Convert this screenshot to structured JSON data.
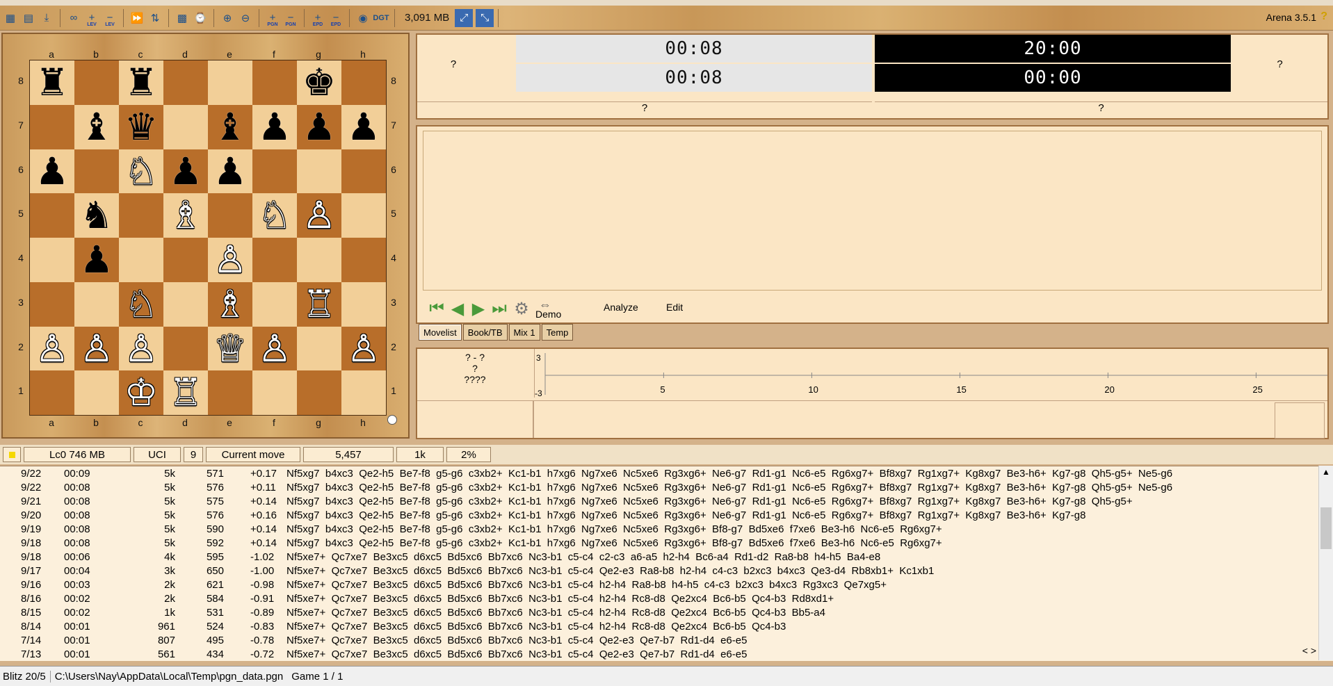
{
  "toolbar": {
    "icons": [
      {
        "name": "board-icon",
        "glyph": "▦",
        "sub": ""
      },
      {
        "name": "open-icon",
        "glyph": "▤",
        "sub": ""
      },
      {
        "name": "save-icon",
        "glyph": "⤓",
        "sub": ""
      },
      {
        "name": "infinite-icon",
        "glyph": "∞",
        "sub": ""
      },
      {
        "name": "level-plus-icon",
        "glyph": "+",
        "sub": "LEV"
      },
      {
        "name": "level-minus-icon",
        "glyph": "−",
        "sub": "LEV"
      },
      {
        "name": "fast-forward-icon",
        "glyph": "⏩",
        "sub": ""
      },
      {
        "name": "flip-icon",
        "glyph": "⇅",
        "sub": ""
      },
      {
        "name": "board-setup-icon",
        "glyph": "▩",
        "sub": ""
      },
      {
        "name": "chess-clock-icon",
        "glyph": "⌚",
        "sub": ""
      },
      {
        "name": "zoom-in-icon",
        "glyph": "⊕",
        "sub": ""
      },
      {
        "name": "zoom-out-icon",
        "glyph": "⊖",
        "sub": ""
      },
      {
        "name": "pgn-plus-icon",
        "glyph": "+",
        "sub": "PGN"
      },
      {
        "name": "pgn-minus-icon",
        "glyph": "−",
        "sub": "PGN"
      },
      {
        "name": "epd-plus-icon",
        "glyph": "+",
        "sub": "EPD"
      },
      {
        "name": "epd-minus-icon",
        "glyph": "−",
        "sub": "EPD"
      },
      {
        "name": "globe-icon",
        "glyph": "◉",
        "sub": ""
      },
      {
        "name": "dgt-icon",
        "glyph": "DGT",
        "sub": ""
      }
    ],
    "memory": "3,091 MB",
    "version": "Arena 3.5.1",
    "version_icon": "?"
  },
  "board": {
    "files": [
      "a",
      "b",
      "c",
      "d",
      "e",
      "f",
      "g",
      "h"
    ],
    "ranks": [
      "8",
      "7",
      "6",
      "5",
      "4",
      "3",
      "2",
      "1"
    ],
    "position": [
      [
        "br",
        "",
        "br",
        "",
        "",
        "",
        "bk",
        ""
      ],
      [
        "",
        "bb",
        "bq",
        "",
        "bb",
        "bp",
        "bp",
        "bp"
      ],
      [
        "bp",
        "",
        "wn",
        "bp",
        "bp",
        "",
        "",
        ""
      ],
      [
        "",
        "bn",
        "",
        "wb",
        "",
        "wn",
        "wp",
        ""
      ],
      [
        "",
        "bp",
        "",
        "",
        "wp",
        "",
        "",
        ""
      ],
      [
        "",
        "",
        "wn",
        "",
        "wb",
        "",
        "wr",
        ""
      ],
      [
        "wp",
        "wp",
        "wp",
        "",
        "wq",
        "wp",
        "",
        "wp"
      ],
      [
        "",
        "",
        "wk",
        "wr",
        "",
        "",
        "",
        ""
      ]
    ]
  },
  "clock": {
    "white_top": "00:08",
    "white_bottom": "00:08",
    "black_top": "20:00",
    "black_bottom": "00:00",
    "left_q": "?",
    "right_q": "?",
    "bottom_left_q": "?",
    "bottom_right_q": "?"
  },
  "nav": {
    "demo": "Demo",
    "analyze": "Analyze",
    "edit": "Edit"
  },
  "tabs": [
    "Movelist",
    "Book/TB",
    "Mix 1",
    "Temp"
  ],
  "graph": {
    "line1": "? - ?",
    "line2": "?",
    "line3": "????",
    "y_top": "3",
    "y_bottom": "-3",
    "x_ticks": [
      "5",
      "10",
      "15",
      "20",
      "25"
    ]
  },
  "engine_status": {
    "engine": "Lc0  746 MB",
    "protocol": "UCI",
    "depth": "9",
    "mode": "Current move",
    "nodes": "5,457",
    "nps": "1k",
    "percent": "2%"
  },
  "analysis": [
    {
      "depth": "9/22",
      "time": "00:09",
      "nodes": "5k",
      "nps": "571",
      "eval": "+0.17",
      "pv": "Nf5xg7  b4xc3  Qe2-h5  Be7-f8  g5-g6  c3xb2+  Kc1-b1  h7xg6  Ng7xe6  Nc5xe6  Rg3xg6+  Ne6-g7  Rd1-g1  Nc6-e5  Rg6xg7+  Bf8xg7  Rg1xg7+  Kg8xg7  Be3-h6+  Kg7-g8  Qh5-g5+  Ne5-g6"
    },
    {
      "depth": "9/22",
      "time": "00:08",
      "nodes": "5k",
      "nps": "576",
      "eval": "+0.11",
      "pv": "Nf5xg7  b4xc3  Qe2-h5  Be7-f8  g5-g6  c3xb2+  Kc1-b1  h7xg6  Ng7xe6  Nc5xe6  Rg3xg6+  Ne6-g7  Rd1-g1  Nc6-e5  Rg6xg7+  Bf8xg7  Rg1xg7+  Kg8xg7  Be3-h6+  Kg7-g8  Qh5-g5+  Ne5-g6"
    },
    {
      "depth": "9/21",
      "time": "00:08",
      "nodes": "5k",
      "nps": "575",
      "eval": "+0.14",
      "pv": "Nf5xg7  b4xc3  Qe2-h5  Be7-f8  g5-g6  c3xb2+  Kc1-b1  h7xg6  Ng7xe6  Nc5xe6  Rg3xg6+  Ne6-g7  Rd1-g1  Nc6-e5  Rg6xg7+  Bf8xg7  Rg1xg7+  Kg8xg7  Be3-h6+  Kg7-g8  Qh5-g5+"
    },
    {
      "depth": "9/20",
      "time": "00:08",
      "nodes": "5k",
      "nps": "576",
      "eval": "+0.16",
      "pv": "Nf5xg7  b4xc3  Qe2-h5  Be7-f8  g5-g6  c3xb2+  Kc1-b1  h7xg6  Ng7xe6  Nc5xe6  Rg3xg6+  Ne6-g7  Rd1-g1  Nc6-e5  Rg6xg7+  Bf8xg7  Rg1xg7+  Kg8xg7  Be3-h6+  Kg7-g8"
    },
    {
      "depth": "9/19",
      "time": "00:08",
      "nodes": "5k",
      "nps": "590",
      "eval": "+0.14",
      "pv": "Nf5xg7  b4xc3  Qe2-h5  Be7-f8  g5-g6  c3xb2+  Kc1-b1  h7xg6  Ng7xe6  Nc5xe6  Rg3xg6+  Bf8-g7  Bd5xe6  f7xe6  Be3-h6  Nc6-e5  Rg6xg7+"
    },
    {
      "depth": "9/18",
      "time": "00:08",
      "nodes": "5k",
      "nps": "592",
      "eval": "+0.14",
      "pv": "Nf5xg7  b4xc3  Qe2-h5  Be7-f8  g5-g6  c3xb2+  Kc1-b1  h7xg6  Ng7xe6  Nc5xe6  Rg3xg6+  Bf8-g7  Bd5xe6  f7xe6  Be3-h6  Nc6-e5  Rg6xg7+"
    },
    {
      "depth": "9/18",
      "time": "00:06",
      "nodes": "4k",
      "nps": "595",
      "eval": "-1.02",
      "pv": "Nf5xe7+  Qc7xe7  Be3xc5  d6xc5  Bd5xc6  Bb7xc6  Nc3-b1  c5-c4  c2-c3  a6-a5  h2-h4  Bc6-a4  Rd1-d2  Ra8-b8  h4-h5  Ba4-e8"
    },
    {
      "depth": "9/17",
      "time": "00:04",
      "nodes": "3k",
      "nps": "650",
      "eval": "-1.00",
      "pv": "Nf5xe7+  Qc7xe7  Be3xc5  d6xc5  Bd5xc6  Bb7xc6  Nc3-b1  c5-c4  Qe2-e3  Ra8-b8  h2-h4  c4-c3  b2xc3  b4xc3  Qe3-d4  Rb8xb1+  Kc1xb1"
    },
    {
      "depth": "9/16",
      "time": "00:03",
      "nodes": "2k",
      "nps": "621",
      "eval": "-0.98",
      "pv": "Nf5xe7+  Qc7xe7  Be3xc5  d6xc5  Bd5xc6  Bb7xc6  Nc3-b1  c5-c4  h2-h4  Ra8-b8  h4-h5  c4-c3  b2xc3  b4xc3  Rg3xc3  Qe7xg5+"
    },
    {
      "depth": "8/16",
      "time": "00:02",
      "nodes": "2k",
      "nps": "584",
      "eval": "-0.91",
      "pv": "Nf5xe7+  Qc7xe7  Be3xc5  d6xc5  Bd5xc6  Bb7xc6  Nc3-b1  c5-c4  h2-h4  Rc8-d8  Qe2xc4  Bc6-b5  Qc4-b3  Rd8xd1+"
    },
    {
      "depth": "8/15",
      "time": "00:02",
      "nodes": "1k",
      "nps": "531",
      "eval": "-0.89",
      "pv": "Nf5xe7+  Qc7xe7  Be3xc5  d6xc5  Bd5xc6  Bb7xc6  Nc3-b1  c5-c4  h2-h4  Rc8-d8  Qe2xc4  Bc6-b5  Qc4-b3  Bb5-a4"
    },
    {
      "depth": "8/14",
      "time": "00:01",
      "nodes": "961",
      "nps": "524",
      "eval": "-0.83",
      "pv": "Nf5xe7+  Qc7xe7  Be3xc5  d6xc5  Bd5xc6  Bb7xc6  Nc3-b1  c5-c4  h2-h4  Rc8-d8  Qe2xc4  Bc6-b5  Qc4-b3"
    },
    {
      "depth": "7/14",
      "time": "00:01",
      "nodes": "807",
      "nps": "495",
      "eval": "-0.78",
      "pv": "Nf5xe7+  Qc7xe7  Be3xc5  d6xc5  Bd5xc6  Bb7xc6  Nc3-b1  c5-c4  Qe2-e3  Qe7-b7  Rd1-d4  e6-e5"
    },
    {
      "depth": "7/13",
      "time": "00:01",
      "nodes": "561",
      "nps": "434",
      "eval": "-0.72",
      "pv": "Nf5xe7+  Qc7xe7  Be3xc5  d6xc5  Bd5xc6  Bb7xc6  Nc3-b1  c5-c4  Qe2-e3  Qe7-b7  Rd1-d4  e6-e5"
    }
  ],
  "statusbar": {
    "mode": "Blitz 20/5",
    "path": "C:\\Users\\Nay\\AppData\\Local\\Temp\\pgn_data.pgn",
    "game": "Game 1 / 1"
  },
  "scroll_arrows": "< >"
}
